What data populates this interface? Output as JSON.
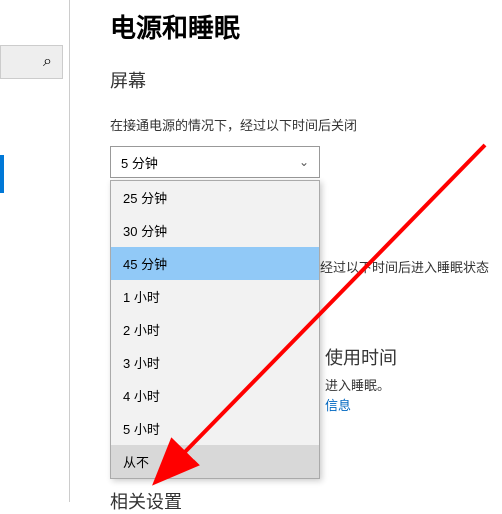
{
  "page": {
    "title": "电源和睡眠"
  },
  "screen_section": {
    "title": "屏幕",
    "label": "在接通电源的情况下，经过以下时间后关闭",
    "selected": "5 分钟"
  },
  "dropdown": {
    "items": [
      {
        "label": "25 分钟"
      },
      {
        "label": "30 分钟"
      },
      {
        "label": "45 分钟"
      },
      {
        "label": "1 小时"
      },
      {
        "label": "2 小时"
      },
      {
        "label": "3 小时"
      },
      {
        "label": "4 小时"
      },
      {
        "label": "5 小时"
      },
      {
        "label": "从不"
      }
    ],
    "highlighted_index": 2,
    "hovered_index": 8
  },
  "behind": {
    "sleep_label": "经过以下时间后进入睡眠状态",
    "usage_title": "使用时间",
    "usage_text": "进入睡眠。",
    "link": "信息"
  },
  "related": {
    "title": "相关设置"
  },
  "icons": {
    "search": "⌕",
    "chevron_down": "⌄"
  },
  "annotation": {
    "arrow_color": "#ff0000"
  }
}
